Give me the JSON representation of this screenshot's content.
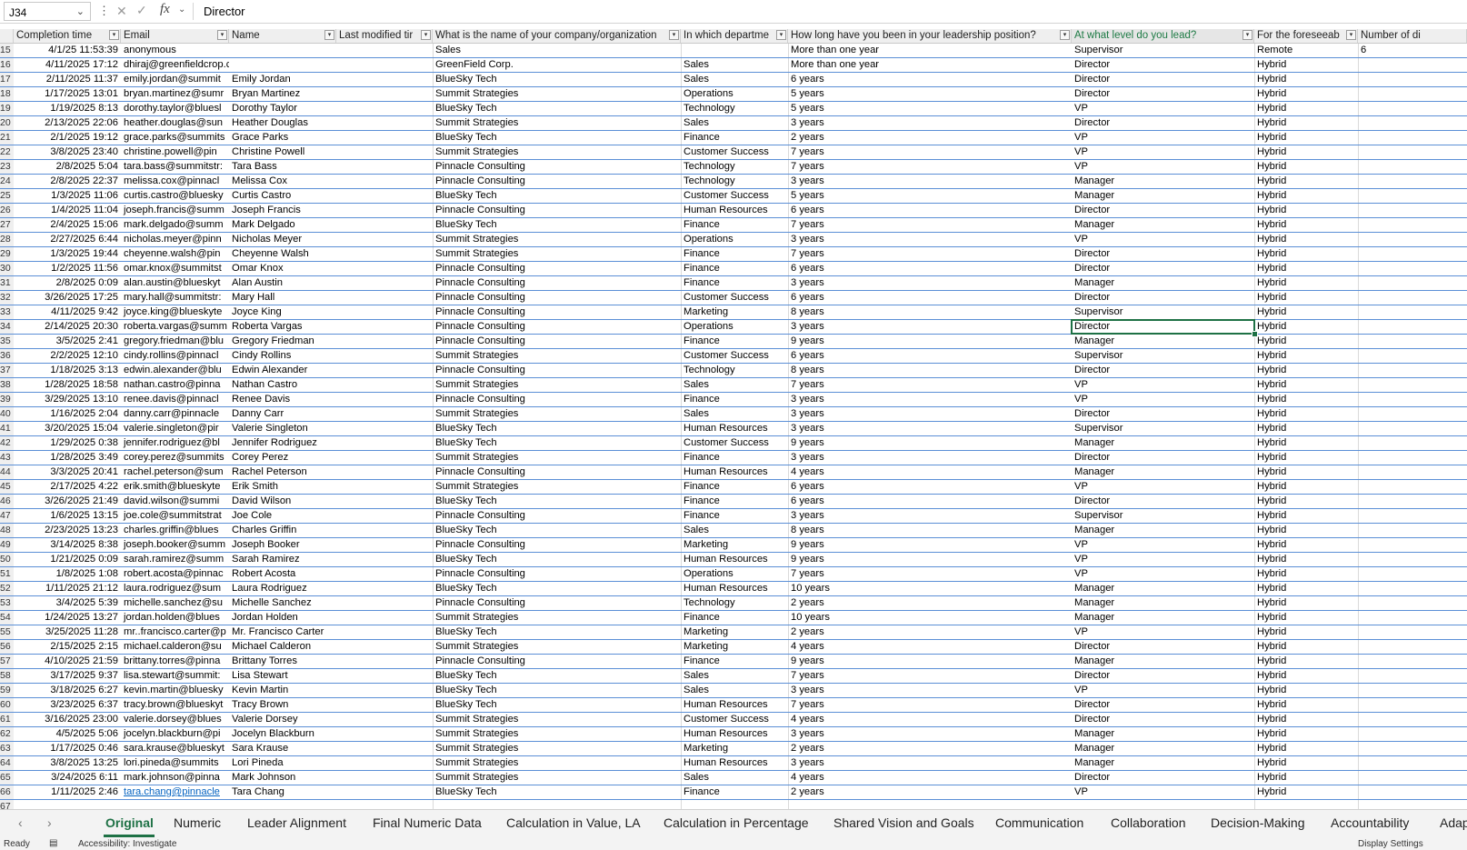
{
  "formula_bar": {
    "name_box": "J34",
    "formula_value": "Director",
    "fx_label": "fx",
    "more_icon": "vertical-dots-icon",
    "cancel_icon": "x-icon",
    "enter_icon": "check-icon"
  },
  "columns": [
    {
      "key": "completion",
      "label": "Completion time"
    },
    {
      "key": "email",
      "label": "Email"
    },
    {
      "key": "name",
      "label": "Name"
    },
    {
      "key": "lastmod",
      "label": "Last modified tir"
    },
    {
      "key": "company",
      "label": "What is the name of your company/organization"
    },
    {
      "key": "dept",
      "label": "In which departme"
    },
    {
      "key": "howlong",
      "label": "How long have you been in your leadership position?"
    },
    {
      "key": "level",
      "label": "At what level do you lead?"
    },
    {
      "key": "foresee",
      "label": "For the foreseeab"
    },
    {
      "key": "number",
      "label": "Number of di"
    }
  ],
  "selection": {
    "cell": "J34",
    "row_index": 19,
    "column": "level"
  },
  "rows": [
    {
      "n": "15",
      "c": "4/1/25 11:53:39",
      "e": "anonymous",
      "nm": "",
      "co": "Sales",
      "d": "",
      "h": "More than one year",
      "l": "Supervisor",
      "f": "Remote",
      "x": "6"
    },
    {
      "n": "16",
      "c": "4/11/2025 17:12",
      "e": "dhiraj@greenfieldcrop.com",
      "nm": "",
      "co": "GreenField Corp.",
      "d": "Sales",
      "h": "More than one year",
      "l": "Director",
      "f": "Hybrid",
      "x": ""
    },
    {
      "n": "17",
      "c": "2/11/2025 11:37",
      "e": "emily.jordan@summit",
      "nm": "Emily Jordan",
      "co": "BlueSky Tech",
      "d": "Sales",
      "h": "6 years",
      "l": "Director",
      "f": "Hybrid",
      "x": ""
    },
    {
      "n": "18",
      "c": "1/17/2025 13:01",
      "e": "bryan.martinez@sumr",
      "nm": "Bryan Martinez",
      "co": "Summit Strategies",
      "d": "Operations",
      "h": "5 years",
      "l": "Director",
      "f": "Hybrid",
      "x": ""
    },
    {
      "n": "19",
      "c": "1/19/2025 8:13",
      "e": "dorothy.taylor@bluesl",
      "nm": "Dorothy Taylor",
      "co": "BlueSky Tech",
      "d": "Technology",
      "h": "5 years",
      "l": "VP",
      "f": "Hybrid",
      "x": ""
    },
    {
      "n": "20",
      "c": "2/13/2025 22:06",
      "e": "heather.douglas@sun",
      "nm": "Heather Douglas",
      "co": "Summit Strategies",
      "d": "Sales",
      "h": "3 years",
      "l": "Director",
      "f": "Hybrid",
      "x": ""
    },
    {
      "n": "21",
      "c": "2/1/2025 19:12",
      "e": "grace.parks@summits",
      "nm": "Grace Parks",
      "co": "BlueSky Tech",
      "d": "Finance",
      "h": "2 years",
      "l": "VP",
      "f": "Hybrid",
      "x": ""
    },
    {
      "n": "22",
      "c": "3/8/2025 23:40",
      "e": "christine.powell@pin",
      "nm": "Christine Powell",
      "co": "Summit Strategies",
      "d": "Customer Success",
      "h": "7 years",
      "l": "VP",
      "f": "Hybrid",
      "x": ""
    },
    {
      "n": "23",
      "c": "2/8/2025 5:04",
      "e": "tara.bass@summitstr:",
      "nm": "Tara Bass",
      "co": "Pinnacle Consulting",
      "d": "Technology",
      "h": "7 years",
      "l": "VP",
      "f": "Hybrid",
      "x": ""
    },
    {
      "n": "24",
      "c": "2/8/2025 22:37",
      "e": "melissa.cox@pinnacl",
      "nm": "Melissa Cox",
      "co": "Pinnacle Consulting",
      "d": "Technology",
      "h": "3 years",
      "l": "Manager",
      "f": "Hybrid",
      "x": ""
    },
    {
      "n": "25",
      "c": "1/3/2025 11:06",
      "e": "curtis.castro@bluesky",
      "nm": "Curtis Castro",
      "co": "BlueSky Tech",
      "d": "Customer Success",
      "h": "5 years",
      "l": "Manager",
      "f": "Hybrid",
      "x": ""
    },
    {
      "n": "26",
      "c": "1/4/2025 11:04",
      "e": "joseph.francis@summ",
      "nm": "Joseph Francis",
      "co": "Pinnacle Consulting",
      "d": "Human Resources",
      "h": "6 years",
      "l": "Director",
      "f": "Hybrid",
      "x": ""
    },
    {
      "n": "27",
      "c": "2/4/2025 15:06",
      "e": "mark.delgado@summ",
      "nm": "Mark Delgado",
      "co": "BlueSky Tech",
      "d": "Finance",
      "h": "7 years",
      "l": "Manager",
      "f": "Hybrid",
      "x": ""
    },
    {
      "n": "28",
      "c": "2/27/2025 6:44",
      "e": "nicholas.meyer@pinn",
      "nm": "Nicholas Meyer",
      "co": "Summit Strategies",
      "d": "Operations",
      "h": "3 years",
      "l": "VP",
      "f": "Hybrid",
      "x": ""
    },
    {
      "n": "29",
      "c": "1/3/2025 19:44",
      "e": "cheyenne.walsh@pin",
      "nm": "Cheyenne Walsh",
      "co": "Summit Strategies",
      "d": "Finance",
      "h": "7 years",
      "l": "Director",
      "f": "Hybrid",
      "x": ""
    },
    {
      "n": "30",
      "c": "1/2/2025 11:56",
      "e": "omar.knox@summitst",
      "nm": "Omar Knox",
      "co": "Pinnacle Consulting",
      "d": "Finance",
      "h": "6 years",
      "l": "Director",
      "f": "Hybrid",
      "x": ""
    },
    {
      "n": "31",
      "c": "2/8/2025 0:09",
      "e": "alan.austin@blueskyt",
      "nm": "Alan Austin",
      "co": "Pinnacle Consulting",
      "d": "Finance",
      "h": "3 years",
      "l": "Manager",
      "f": "Hybrid",
      "x": ""
    },
    {
      "n": "32",
      "c": "3/26/2025 17:25",
      "e": "mary.hall@summitstr:",
      "nm": "Mary Hall",
      "co": "Pinnacle Consulting",
      "d": "Customer Success",
      "h": "6 years",
      "l": "Director",
      "f": "Hybrid",
      "x": ""
    },
    {
      "n": "33",
      "c": "4/11/2025 9:42",
      "e": "joyce.king@blueskyte",
      "nm": "Joyce King",
      "co": "Pinnacle Consulting",
      "d": "Marketing",
      "h": "8 years",
      "l": "Supervisor",
      "f": "Hybrid",
      "x": ""
    },
    {
      "n": "34",
      "c": "2/14/2025 20:30",
      "e": "roberta.vargas@summ",
      "nm": "Roberta Vargas",
      "co": "Pinnacle Consulting",
      "d": "Operations",
      "h": "3 years",
      "l": "Director",
      "f": "Hybrid",
      "x": ""
    },
    {
      "n": "35",
      "c": "3/5/2025 2:41",
      "e": "gregory.friedman@blu",
      "nm": "Gregory Friedman",
      "co": "Pinnacle Consulting",
      "d": "Finance",
      "h": "9 years",
      "l": "Manager",
      "f": "Hybrid",
      "x": ""
    },
    {
      "n": "36",
      "c": "2/2/2025 12:10",
      "e": "cindy.rollins@pinnacl",
      "nm": "Cindy Rollins",
      "co": "Summit Strategies",
      "d": "Customer Success",
      "h": "6 years",
      "l": "Supervisor",
      "f": "Hybrid",
      "x": ""
    },
    {
      "n": "37",
      "c": "1/18/2025 3:13",
      "e": "edwin.alexander@blu",
      "nm": "Edwin Alexander",
      "co": "Pinnacle Consulting",
      "d": "Technology",
      "h": "8 years",
      "l": "Director",
      "f": "Hybrid",
      "x": ""
    },
    {
      "n": "38",
      "c": "1/28/2025 18:58",
      "e": "nathan.castro@pinna",
      "nm": "Nathan Castro",
      "co": "Summit Strategies",
      "d": "Sales",
      "h": "7 years",
      "l": "VP",
      "f": "Hybrid",
      "x": ""
    },
    {
      "n": "39",
      "c": "3/29/2025 13:10",
      "e": "renee.davis@pinnacl",
      "nm": "Renee Davis",
      "co": "Pinnacle Consulting",
      "d": "Finance",
      "h": "3 years",
      "l": "VP",
      "f": "Hybrid",
      "x": ""
    },
    {
      "n": "40",
      "c": "1/16/2025 2:04",
      "e": "danny.carr@pinnacle",
      "nm": "Danny Carr",
      "co": "Summit Strategies",
      "d": "Sales",
      "h": "3 years",
      "l": "Director",
      "f": "Hybrid",
      "x": ""
    },
    {
      "n": "41",
      "c": "3/20/2025 15:04",
      "e": "valerie.singleton@pir",
      "nm": "Valerie Singleton",
      "co": "BlueSky Tech",
      "d": "Human Resources",
      "h": "3 years",
      "l": "Supervisor",
      "f": "Hybrid",
      "x": ""
    },
    {
      "n": "42",
      "c": "1/29/2025 0:38",
      "e": "jennifer.rodriguez@bl",
      "nm": "Jennifer Rodriguez",
      "co": "BlueSky Tech",
      "d": "Customer Success",
      "h": "9 years",
      "l": "Manager",
      "f": "Hybrid",
      "x": ""
    },
    {
      "n": "43",
      "c": "1/28/2025 3:49",
      "e": "corey.perez@summits",
      "nm": "Corey Perez",
      "co": "Summit Strategies",
      "d": "Finance",
      "h": "3 years",
      "l": "Director",
      "f": "Hybrid",
      "x": ""
    },
    {
      "n": "44",
      "c": "3/3/2025 20:41",
      "e": "rachel.peterson@sum",
      "nm": "Rachel Peterson",
      "co": "Pinnacle Consulting",
      "d": "Human Resources",
      "h": "4 years",
      "l": "Manager",
      "f": "Hybrid",
      "x": ""
    },
    {
      "n": "45",
      "c": "2/17/2025 4:22",
      "e": "erik.smith@blueskyte",
      "nm": "Erik Smith",
      "co": "Summit Strategies",
      "d": "Finance",
      "h": "6 years",
      "l": "VP",
      "f": "Hybrid",
      "x": ""
    },
    {
      "n": "46",
      "c": "3/26/2025 21:49",
      "e": "david.wilson@summi",
      "nm": "David Wilson",
      "co": "BlueSky Tech",
      "d": "Finance",
      "h": "6 years",
      "l": "Director",
      "f": "Hybrid",
      "x": ""
    },
    {
      "n": "47",
      "c": "1/6/2025 13:15",
      "e": "joe.cole@summitstrat",
      "nm": "Joe Cole",
      "co": "Pinnacle Consulting",
      "d": "Finance",
      "h": "3 years",
      "l": "Supervisor",
      "f": "Hybrid",
      "x": ""
    },
    {
      "n": "48",
      "c": "2/23/2025 13:23",
      "e": "charles.griffin@blues",
      "nm": "Charles Griffin",
      "co": "BlueSky Tech",
      "d": "Sales",
      "h": "8 years",
      "l": "Manager",
      "f": "Hybrid",
      "x": ""
    },
    {
      "n": "49",
      "c": "3/14/2025 8:38",
      "e": "joseph.booker@summ",
      "nm": "Joseph Booker",
      "co": "Pinnacle Consulting",
      "d": "Marketing",
      "h": "9 years",
      "l": "VP",
      "f": "Hybrid",
      "x": ""
    },
    {
      "n": "50",
      "c": "1/21/2025 0:09",
      "e": "sarah.ramirez@summ",
      "nm": "Sarah Ramirez",
      "co": "BlueSky Tech",
      "d": "Human Resources",
      "h": "9 years",
      "l": "VP",
      "f": "Hybrid",
      "x": ""
    },
    {
      "n": "51",
      "c": "1/8/2025 1:08",
      "e": "robert.acosta@pinnac",
      "nm": "Robert Acosta",
      "co": "Pinnacle Consulting",
      "d": "Operations",
      "h": "7 years",
      "l": "VP",
      "f": "Hybrid",
      "x": ""
    },
    {
      "n": "52",
      "c": "1/11/2025 21:12",
      "e": "laura.rodriguez@sum",
      "nm": "Laura Rodriguez",
      "co": "BlueSky Tech",
      "d": "Human Resources",
      "h": "10 years",
      "l": "Manager",
      "f": "Hybrid",
      "x": ""
    },
    {
      "n": "53",
      "c": "3/4/2025 5:39",
      "e": "michelle.sanchez@su",
      "nm": "Michelle Sanchez",
      "co": "Pinnacle Consulting",
      "d": "Technology",
      "h": "2 years",
      "l": "Manager",
      "f": "Hybrid",
      "x": ""
    },
    {
      "n": "54",
      "c": "1/24/2025 13:27",
      "e": "jordan.holden@blues",
      "nm": "Jordan Holden",
      "co": "Summit Strategies",
      "d": "Finance",
      "h": "10 years",
      "l": "Manager",
      "f": "Hybrid",
      "x": ""
    },
    {
      "n": "55",
      "c": "3/25/2025 11:28",
      "e": "mr..francisco.carter@p",
      "nm": "Mr. Francisco Carter",
      "co": "BlueSky Tech",
      "d": "Marketing",
      "h": "2 years",
      "l": "VP",
      "f": "Hybrid",
      "x": ""
    },
    {
      "n": "56",
      "c": "2/15/2025 2:15",
      "e": "michael.calderon@su",
      "nm": "Michael Calderon",
      "co": "Summit Strategies",
      "d": "Marketing",
      "h": "4 years",
      "l": "Director",
      "f": "Hybrid",
      "x": ""
    },
    {
      "n": "57",
      "c": "4/10/2025 21:59",
      "e": "brittany.torres@pinna",
      "nm": "Brittany Torres",
      "co": "Pinnacle Consulting",
      "d": "Finance",
      "h": "9 years",
      "l": "Manager",
      "f": "Hybrid",
      "x": ""
    },
    {
      "n": "58",
      "c": "3/17/2025 9:37",
      "e": "lisa.stewart@summit:",
      "nm": "Lisa Stewart",
      "co": "BlueSky Tech",
      "d": "Sales",
      "h": "7 years",
      "l": "Director",
      "f": "Hybrid",
      "x": ""
    },
    {
      "n": "59",
      "c": "3/18/2025 6:27",
      "e": "kevin.martin@bluesky",
      "nm": "Kevin Martin",
      "co": "BlueSky Tech",
      "d": "Sales",
      "h": "3 years",
      "l": "VP",
      "f": "Hybrid",
      "x": ""
    },
    {
      "n": "60",
      "c": "3/23/2025 6:37",
      "e": "tracy.brown@blueskyt",
      "nm": "Tracy Brown",
      "co": "BlueSky Tech",
      "d": "Human Resources",
      "h": "7 years",
      "l": "Director",
      "f": "Hybrid",
      "x": ""
    },
    {
      "n": "61",
      "c": "3/16/2025 23:00",
      "e": "valerie.dorsey@blues",
      "nm": "Valerie Dorsey",
      "co": "Summit Strategies",
      "d": "Customer Success",
      "h": "4 years",
      "l": "Director",
      "f": "Hybrid",
      "x": ""
    },
    {
      "n": "62",
      "c": "4/5/2025 5:06",
      "e": "jocelyn.blackburn@pi",
      "nm": "Jocelyn Blackburn",
      "co": "Summit Strategies",
      "d": "Human Resources",
      "h": "3 years",
      "l": "Manager",
      "f": "Hybrid",
      "x": ""
    },
    {
      "n": "63",
      "c": "1/17/2025 0:46",
      "e": "sara.krause@blueskyt",
      "nm": "Sara Krause",
      "co": "Summit Strategies",
      "d": "Marketing",
      "h": "2 years",
      "l": "Manager",
      "f": "Hybrid",
      "x": ""
    },
    {
      "n": "64",
      "c": "3/8/2025 13:25",
      "e": "lori.pineda@summits",
      "nm": "Lori Pineda",
      "co": "Summit Strategies",
      "d": "Human Resources",
      "h": "3 years",
      "l": "Manager",
      "f": "Hybrid",
      "x": ""
    },
    {
      "n": "65",
      "c": "3/24/2025 6:11",
      "e": "mark.johnson@pinna",
      "nm": "Mark Johnson",
      "co": "Summit Strategies",
      "d": "Sales",
      "h": "4 years",
      "l": "Director",
      "f": "Hybrid",
      "x": ""
    },
    {
      "n": "66",
      "c": "1/11/2025 2:46",
      "e": "tara.chang@pinnacle",
      "nm": "Tara Chang",
      "co": "BlueSky Tech",
      "d": "Finance",
      "h": "2 years",
      "l": "VP",
      "f": "Hybrid",
      "x": "",
      "link": true
    },
    {
      "n": "67",
      "c": "",
      "e": "",
      "nm": "",
      "co": "",
      "d": "",
      "h": "",
      "l": "",
      "f": "",
      "x": ""
    }
  ],
  "sheet_tabs": {
    "nav_prev_icon": "chevron-left-icon",
    "nav_next_icon": "chevron-right-icon",
    "tabs": [
      "Original",
      "Numeric",
      "Leader Alignment",
      "Final Numeric Data",
      "Calculation in Value, LA",
      "Calculation in Percentage",
      "Shared Vision and Goals",
      "Communication",
      "Collaboration",
      "Decision-Making",
      "Accountability",
      "Adap"
    ],
    "active_tab": "Original"
  },
  "status_bar": {
    "ready": "Ready",
    "accessibility": "Accessibility: Investigate",
    "display_settings": "Display Settings"
  },
  "colors": {
    "accent_green": "#1e7145",
    "row_border_blue": "#5b8fd6",
    "link_blue": "#0563c1"
  }
}
